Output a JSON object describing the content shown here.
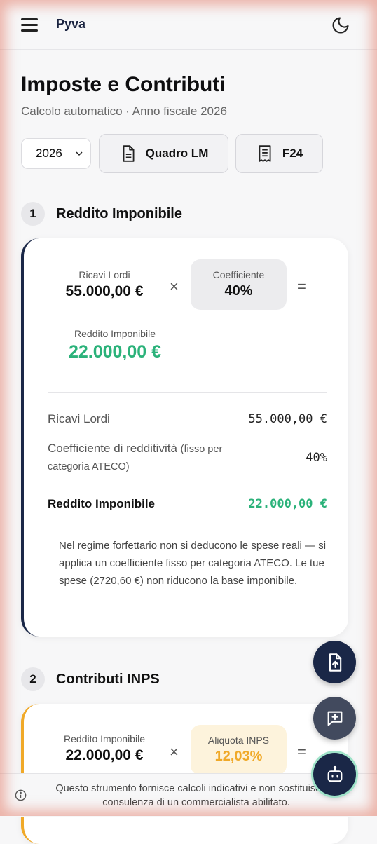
{
  "header": {
    "logo": "Pyva",
    "menu_icon": "hamburger-icon",
    "theme_icon": "moon-icon"
  },
  "page": {
    "title": "Imposte e Contributi",
    "subtitle": "Calcolo automatico · Anno fiscale 2026"
  },
  "toolbar": {
    "year_selected": "2026",
    "quadro_label": "Quadro LM",
    "f24_label": "F24"
  },
  "section1": {
    "number": "1",
    "title": "Reddito Imponibile",
    "formula": {
      "left_label": "Ricavi Lordi",
      "left_value": "55.000,00 €",
      "op_times": "×",
      "coef_label": "Coefficiente",
      "coef_value": "40%",
      "op_equals": "=",
      "result_label": "Reddito Imponibile",
      "result_value": "22.000,00 €"
    },
    "rows": [
      {
        "label": "Ricavi Lordi",
        "value": "55.000,00 €"
      },
      {
        "label": "Coefficiente di redditività",
        "hint": "(fisso per categoria ATECO)",
        "value": "40%"
      }
    ],
    "total": {
      "label": "Reddito Imponibile",
      "value": "22.000,00 €"
    },
    "note": "Nel regime forfettario non si deducono le spese reali — si applica un coefficiente fisso per categoria ATECO. Le tue spese (2720,60 €) non riducono la base imponibile."
  },
  "section2": {
    "number": "2",
    "title": "Contributi INPS",
    "formula": {
      "left_label": "Reddito Imponibile",
      "left_value": "22.000,00 €",
      "op_times": "×",
      "rate_label": "Aliquota INPS",
      "rate_value": "12,03%",
      "op_equals": "="
    }
  },
  "fabs": [
    "upload-file-icon",
    "add-comment-icon",
    "robot-assistant-icon"
  ],
  "footer": {
    "disclaimer": "Questo strumento fornisce calcoli indicativi e non sostituisce la consulenza di un commercialista abilitato."
  },
  "colors": {
    "navy": "#1a2747",
    "green": "#2bb27a",
    "amber": "#f0a928",
    "amber_text": "#f0a928"
  }
}
